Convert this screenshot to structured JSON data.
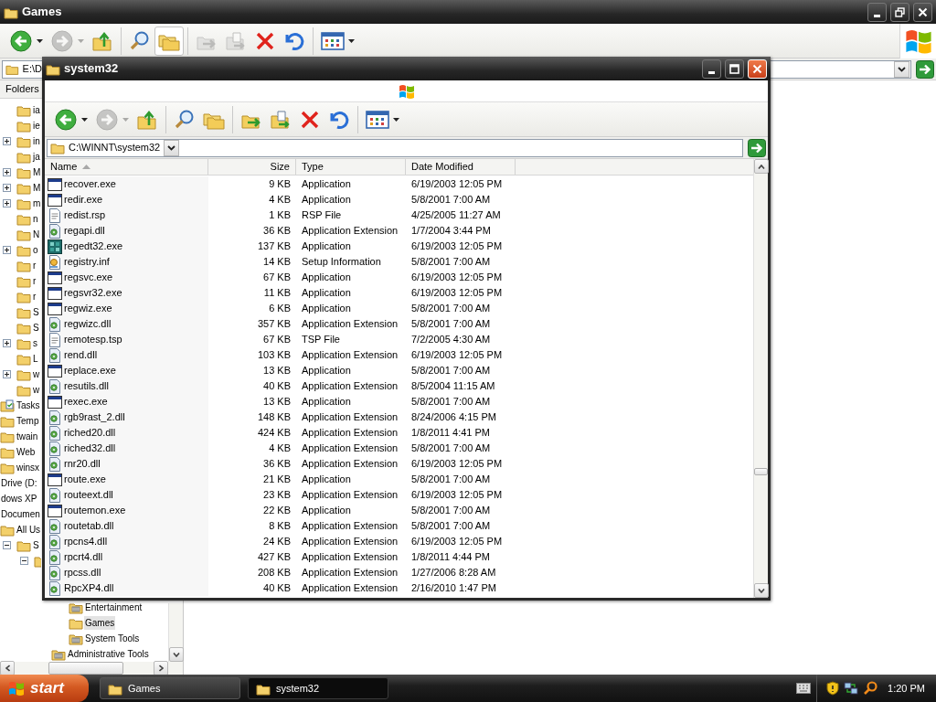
{
  "background_window": {
    "title": "Games",
    "toolbar": [
      [
        {
          "kind": "back",
          "disabled": false,
          "pressed": false
        },
        {
          "kind": "forward",
          "disabled": true,
          "pressed": false
        },
        {
          "kind": "up",
          "disabled": false,
          "pressed": false
        }
      ],
      [
        {
          "kind": "search",
          "disabled": false,
          "pressed": false
        },
        {
          "kind": "folders",
          "disabled": false,
          "pressed": true
        }
      ],
      [
        {
          "kind": "move",
          "disabled": true,
          "pressed": false
        },
        {
          "kind": "copy",
          "disabled": true,
          "pressed": false
        },
        {
          "kind": "delete",
          "disabled": false,
          "pressed": false
        },
        {
          "kind": "undo",
          "disabled": false,
          "pressed": false
        }
      ],
      [
        {
          "kind": "views",
          "disabled": false,
          "pressed": false
        }
      ]
    ],
    "address": "E:\\D",
    "pane_title": "Folders",
    "tree": {
      "continued": [
        {
          "label": "ia",
          "kind": "folder",
          "selected": false
        },
        {
          "label": "ie",
          "kind": "folder",
          "selected": false
        },
        {
          "label": "in",
          "expanded": false,
          "kind": "folder",
          "selected": false
        },
        {
          "label": "ja",
          "kind": "folder",
          "selected": false
        },
        {
          "label": "M",
          "expanded": false,
          "kind": "folder",
          "selected": false
        },
        {
          "label": "M",
          "expanded": false,
          "kind": "folder",
          "selected": false
        },
        {
          "label": "m",
          "expanded": false,
          "kind": "folder",
          "selected": false
        },
        {
          "label": "n",
          "kind": "folder",
          "selected": false
        },
        {
          "label": "N",
          "kind": "folder",
          "selected": false
        },
        {
          "label": "o",
          "expanded": false,
          "kind": "folder",
          "selected": false
        },
        {
          "label": "r",
          "kind": "folder",
          "selected": false
        },
        {
          "label": "r",
          "kind": "folder",
          "selected": false
        },
        {
          "label": "r",
          "kind": "folder",
          "selected": false
        },
        {
          "label": "S",
          "kind": "folder",
          "selected": false
        },
        {
          "label": "S",
          "kind": "folder",
          "selected": false
        },
        {
          "label": "s",
          "expanded": false,
          "kind": "folder",
          "selected": false
        },
        {
          "label": "L",
          "kind": "folder",
          "selected": false
        },
        {
          "label": "w",
          "expanded": false,
          "kind": "folder",
          "selected": false
        },
        {
          "label": "w",
          "kind": "folder",
          "selected": false
        }
      ],
      "items": [
        {
          "label": "Tasks",
          "kind": "tasks",
          "selected": false
        },
        {
          "label": "Temp",
          "kind": "folder",
          "selected": false
        },
        {
          "label": "twain",
          "kind": "folder",
          "selected": false
        },
        {
          "label": "Web",
          "kind": "folder",
          "selected": false
        },
        {
          "label": "winsx",
          "kind": "folder",
          "selected": false
        },
        {
          "label": "Drive (D:",
          "selected": false
        },
        {
          "label": "dows XP",
          "selected": false
        },
        {
          "label": "Documen",
          "selected": false
        },
        {
          "label": "All Us",
          "kind": "folder",
          "selected": false,
          "children": [
            {
              "label": "S",
              "expanded": true,
              "kind": "folder",
              "selected": false,
              "children": [
                {
                  "expanded": true,
                  "kind": "folder",
                  "children": [
                    {
                      "children": [
                        {
                          "label": "Entertainment",
                          "kind": "group",
                          "selected": false
                        },
                        {
                          "label": "Games",
                          "kind": "folder",
                          "selected": true
                        },
                        {
                          "label": "System Tools",
                          "kind": "group",
                          "selected": false
                        }
                      ]
                    },
                    {
                      "label": "Administrative Tools",
                      "kind": "group",
                      "selected": false
                    }
                  ]
                }
              ]
            }
          ]
        }
      ]
    }
  },
  "window": {
    "title": "system32",
    "toolbar": [
      [
        {
          "kind": "back",
          "disabled": false,
          "pressed": false
        },
        {
          "kind": "forward",
          "disabled": true,
          "pressed": false
        },
        {
          "kind": "up",
          "disabled": false,
          "pressed": false
        }
      ],
      [
        {
          "kind": "search",
          "disabled": false,
          "pressed": false
        },
        {
          "kind": "folders",
          "disabled": false,
          "pressed": false
        }
      ],
      [
        {
          "kind": "move",
          "disabled": false,
          "pressed": false
        },
        {
          "kind": "copy",
          "disabled": false,
          "pressed": false
        },
        {
          "kind": "delete",
          "disabled": false,
          "pressed": false
        },
        {
          "kind": "undo",
          "disabled": false,
          "pressed": false
        }
      ],
      [
        {
          "kind": "views",
          "disabled": false,
          "pressed": false
        }
      ]
    ],
    "address": "C:\\WINNT\\system32",
    "columns": [
      {
        "label": "Name",
        "sorted": true
      },
      {
        "label": "Size",
        "sorted": false
      },
      {
        "label": "Type",
        "sorted": false
      },
      {
        "label": "Date Modified",
        "sorted": false
      }
    ],
    "files": [
      {
        "name": "recover.exe",
        "size": "9 KB",
        "type": "Application",
        "date": "6/19/2003 12:05 PM",
        "kind": "app"
      },
      {
        "name": "redir.exe",
        "size": "4 KB",
        "type": "Application",
        "date": "5/8/2001 7:00 AM",
        "kind": "app"
      },
      {
        "name": "redist.rsp",
        "size": "1 KB",
        "type": "RSP File",
        "date": "4/25/2005 11:27 AM",
        "kind": "file"
      },
      {
        "name": "regapi.dll",
        "size": "36 KB",
        "type": "Application Extension",
        "date": "1/7/2004 3:44 PM",
        "kind": "dll"
      },
      {
        "name": "regedt32.exe",
        "size": "137 KB",
        "type": "Application",
        "date": "6/19/2003 12:05 PM",
        "kind": "regedit"
      },
      {
        "name": "registry.inf",
        "size": "14 KB",
        "type": "Setup Information",
        "date": "5/8/2001 7:00 AM",
        "kind": "setup"
      },
      {
        "name": "regsvc.exe",
        "size": "67 KB",
        "type": "Application",
        "date": "6/19/2003 12:05 PM",
        "kind": "app"
      },
      {
        "name": "regsvr32.exe",
        "size": "11 KB",
        "type": "Application",
        "date": "6/19/2003 12:05 PM",
        "kind": "app"
      },
      {
        "name": "regwiz.exe",
        "size": "6 KB",
        "type": "Application",
        "date": "5/8/2001 7:00 AM",
        "kind": "app"
      },
      {
        "name": "regwizc.dll",
        "size": "357 KB",
        "type": "Application Extension",
        "date": "5/8/2001 7:00 AM",
        "kind": "dll"
      },
      {
        "name": "remotesp.tsp",
        "size": "67 KB",
        "type": "TSP File",
        "date": "7/2/2005 4:30 AM",
        "kind": "file"
      },
      {
        "name": "rend.dll",
        "size": "103 KB",
        "type": "Application Extension",
        "date": "6/19/2003 12:05 PM",
        "kind": "dll"
      },
      {
        "name": "replace.exe",
        "size": "13 KB",
        "type": "Application",
        "date": "5/8/2001 7:00 AM",
        "kind": "app"
      },
      {
        "name": "resutils.dll",
        "size": "40 KB",
        "type": "Application Extension",
        "date": "8/5/2004 11:15 AM",
        "kind": "dll"
      },
      {
        "name": "rexec.exe",
        "size": "13 KB",
        "type": "Application",
        "date": "5/8/2001 7:00 AM",
        "kind": "app"
      },
      {
        "name": "rgb9rast_2.dll",
        "size": "148 KB",
        "type": "Application Extension",
        "date": "8/24/2006 4:15 PM",
        "kind": "dll"
      },
      {
        "name": "riched20.dll",
        "size": "424 KB",
        "type": "Application Extension",
        "date": "1/8/2011 4:41 PM",
        "kind": "dll"
      },
      {
        "name": "riched32.dll",
        "size": "4 KB",
        "type": "Application Extension",
        "date": "5/8/2001 7:00 AM",
        "kind": "dll"
      },
      {
        "name": "rnr20.dll",
        "size": "36 KB",
        "type": "Application Extension",
        "date": "6/19/2003 12:05 PM",
        "kind": "dll"
      },
      {
        "name": "route.exe",
        "size": "21 KB",
        "type": "Application",
        "date": "5/8/2001 7:00 AM",
        "kind": "app"
      },
      {
        "name": "routeext.dll",
        "size": "23 KB",
        "type": "Application Extension",
        "date": "6/19/2003 12:05 PM",
        "kind": "dll"
      },
      {
        "name": "routemon.exe",
        "size": "22 KB",
        "type": "Application",
        "date": "5/8/2001 7:00 AM",
        "kind": "app"
      },
      {
        "name": "routetab.dll",
        "size": "8 KB",
        "type": "Application Extension",
        "date": "5/8/2001 7:00 AM",
        "kind": "dll"
      },
      {
        "name": "rpcns4.dll",
        "size": "24 KB",
        "type": "Application Extension",
        "date": "6/19/2003 12:05 PM",
        "kind": "dll"
      },
      {
        "name": "rpcrt4.dll",
        "size": "427 KB",
        "type": "Application Extension",
        "date": "1/8/2011 4:44 PM",
        "kind": "dll"
      },
      {
        "name": "rpcss.dll",
        "size": "208 KB",
        "type": "Application Extension",
        "date": "1/27/2006 8:28 AM",
        "kind": "dll"
      },
      {
        "name": "RpcXP4.dll",
        "size": "40 KB",
        "type": "Application Extension",
        "date": "2/16/2010 1:47 PM",
        "kind": "dll"
      }
    ]
  },
  "taskbar": {
    "start": "start",
    "tasks": [
      {
        "label": "Games",
        "selected": false
      },
      {
        "label": "system32",
        "selected": true
      }
    ],
    "clock": "1:20 PM"
  }
}
